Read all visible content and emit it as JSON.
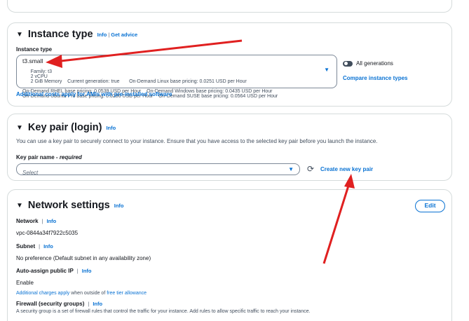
{
  "instance_type": {
    "title": "Instance type",
    "info": "Info",
    "get_advice": "Get advice",
    "field_label": "Instance type",
    "selected": "t3.small",
    "line1_family": "Family: t3",
    "line1_cpu": "2 vCPU",
    "line1_rest": "2 GiB Memory    Current generation: true       On-Demand Linux base pricing: 0.0251 USD per Hour",
    "line2": "On-Demand RHEL base pricing: 0.0539 USD per Hour    On-Demand Windows base pricing: 0.0435 USD per Hour",
    "line3": "On-Demand Ubuntu Pro base pricing: 0.0286 USD per Hour    On-Demand SUSE base pricing: 0.0564 USD per Hour",
    "all_generations": "All generations",
    "compare": "Compare instance types",
    "additional_costs": "Additional costs apply for AMIs with pre-installed software"
  },
  "key_pair": {
    "title": "Key pair (login)",
    "info": "Info",
    "description": "You can use a key pair to securely connect to your instance. Ensure that you have access to the selected key pair before you launch the instance.",
    "name_label": "Key pair name - ",
    "required": "required",
    "select_placeholder": "Select",
    "create_new": "Create new key pair"
  },
  "network": {
    "title": "Network settings",
    "info": "Info",
    "edit": "Edit",
    "network_label": "Network",
    "network_value": "vpc-0844a34f7922c5035",
    "subnet_label": "Subnet",
    "subnet_value": "No preference (Default subnet in any availability zone)",
    "public_ip_label": "Auto-assign public IP",
    "public_ip_value": "Enable",
    "charges_link": "Additional charges apply",
    "charges_mid": " when outside of ",
    "free_tier_link": "free tier allowance",
    "firewall_label": "Firewall (security groups)",
    "firewall_desc": "A security group is a set of firewall rules that control the traffic for your instance. Add rules to allow specific traffic to reach your instance."
  },
  "colors": {
    "link": "#0972d3",
    "annotation_arrow": "#e02020",
    "border": "#d5dbdb"
  },
  "icons": [
    "caret-down-icon",
    "dropdown-icon",
    "refresh-icon",
    "toggle-icon"
  ]
}
